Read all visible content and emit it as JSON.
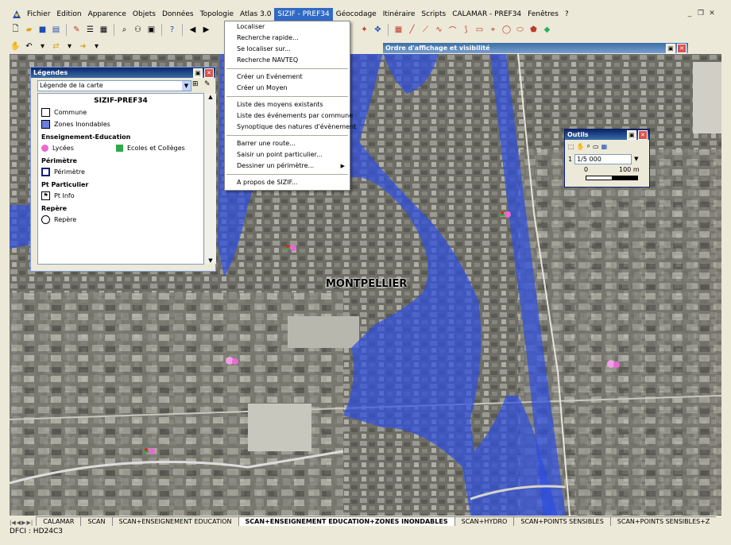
{
  "menubar": {
    "items": [
      "Fichier",
      "Edition",
      "Apparence",
      "Objets",
      "Données",
      "Topologie",
      "Atlas 3.0",
      "SIZIF - PREF34",
      "Géocodage",
      "Itinéraire",
      "Scripts",
      "CALAMAR - PREF34",
      "Fenêtres",
      "?"
    ],
    "active_index": 7
  },
  "dropdown": {
    "groups": [
      [
        "Localiser",
        "Recherche rapide...",
        "Se localiser sur...",
        "Recherche NAVTEQ"
      ],
      [
        "Créer un Evénement",
        "Créer un Moyen"
      ],
      [
        "Liste des moyens existants",
        "Liste des événements par commune",
        "Synoptique des natures d'évènement"
      ],
      [
        "Barrer une route...",
        "Saisir un point particulier...",
        "Dessiner un périmètre..."
      ],
      [
        "A propos de SIZIF..."
      ]
    ],
    "submenu_item": "Dessiner un périmètre..."
  },
  "legend": {
    "panel_title": "Légendes",
    "select_value": "Légende de la carte",
    "heading": "SIZIF-PREF34",
    "rows_top": [
      {
        "label": "Commune",
        "symbol": "white-square"
      },
      {
        "label": "Zones Inondables",
        "symbol": "blue-square"
      }
    ],
    "group_education": "Enseignement-Education",
    "lycees": "Lycées",
    "ecoles": "Ecoles et Collèges",
    "group_perimetre": "Périmètre",
    "perimetre": "Périmètre",
    "group_pt": "Pt Particulier",
    "pt_info": "Pt Info",
    "group_repere": "Repère",
    "repere": "Repère"
  },
  "order_panel": {
    "title": "Ordre d'affichage et visibilité"
  },
  "outils": {
    "title": "Outils",
    "row_number": "1",
    "scale_value": "1/5 000",
    "scale_left": "0",
    "scale_right": "100 m"
  },
  "map": {
    "city_label": "MONTPELLIER",
    "flood_color": "#2f4fe0"
  },
  "tabs": [
    {
      "label": "CALAMAR",
      "active": false
    },
    {
      "label": "SCAN",
      "active": false
    },
    {
      "label": "SCAN+ENSEIGNEMENT EDUCATION",
      "active": false
    },
    {
      "label": "SCAN+ENSEIGNEMENT EDUCATION+ZONES INONDABLES",
      "active": true
    },
    {
      "label": "SCAN+HYDRO",
      "active": false
    },
    {
      "label": "SCAN+POINTS SENSIBLES",
      "active": false
    },
    {
      "label": "SCAN+POINTS SENSIBLES+Z",
      "active": false
    }
  ],
  "status": {
    "text": "DFCI : HD24C3"
  }
}
